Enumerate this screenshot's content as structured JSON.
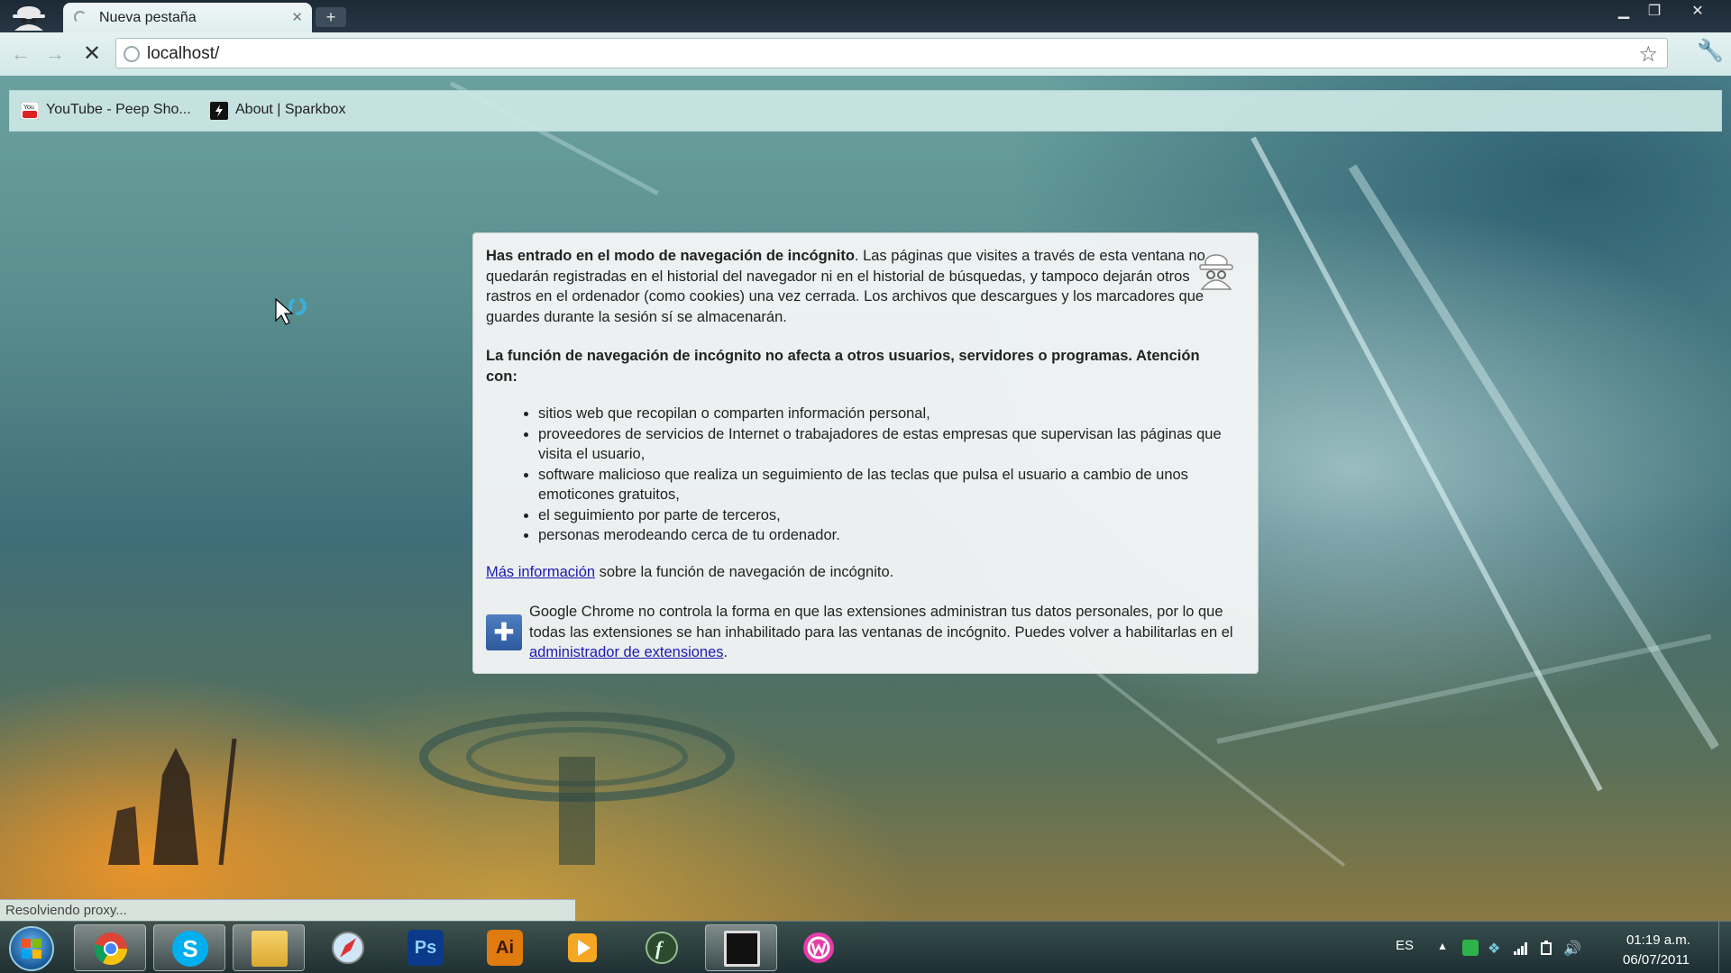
{
  "browser": {
    "tab_title": "Nueva pestaña",
    "url": "localhost/",
    "status_text": "Resolviendo proxy..."
  },
  "bookmarks": [
    {
      "label": "YouTube - Peep Sho...",
      "icon": "youtube-icon"
    },
    {
      "label": "About | Sparkbox",
      "icon": "sparkbox-icon"
    }
  ],
  "incognito": {
    "p1_bold": "Has entrado en el modo de navegación de incógnito",
    "p1_text": ". Las páginas que visites a través de esta ventana no quedarán registradas en el historial del navegador ni en el historial de búsquedas, y tampoco dejarán otros rastros en el ordenador (como cookies) una vez cerrada. Los archivos que descargues y los marcadores que guardes durante la sesión sí se almacenarán.",
    "p2_bold": "La función de navegación de incógnito no afecta a otros usuarios, servidores o programas. Atención con:",
    "bullets": [
      "sitios web que recopilan o comparten información personal,",
      "proveedores de servicios de Internet o trabajadores de estas empresas que supervisan las páginas que visita el usuario,",
      "software malicioso que realiza un seguimiento de las teclas que pulsa el usuario a cambio de unos emoticones gratuitos,",
      "el seguimiento por parte de terceros,",
      "personas merodeando cerca de tu ordenador."
    ],
    "more_info_link": "Más información",
    "more_info_text": " sobre la función de navegación de incógnito.",
    "ext_text": "Google Chrome no controla la forma en que las extensiones administran tus datos personales, por lo que todas las extensiones se han inhabilitado para las ventanas de incógnito. Puedes volver a habilitarlas en el ",
    "ext_link": "administrador de extensiones",
    "ext_end": "."
  },
  "taskbar": {
    "apps": [
      "windows-start",
      "chrome",
      "skype",
      "explorer",
      "safari",
      "photoshop",
      "illustrator",
      "media-player",
      "app-f",
      "app-square",
      "wamp"
    ],
    "ps_label": "Ps",
    "ai_label": "Ai",
    "language": "ES",
    "time": "01:19 a.m.",
    "date": "06/07/2011"
  },
  "colors": {
    "link": "#1a1ab0",
    "toolbar": "#d4e8e8",
    "photoshop": "#0b3a8a",
    "illustrator": "#e07b10",
    "wamp": "#e43da8"
  }
}
